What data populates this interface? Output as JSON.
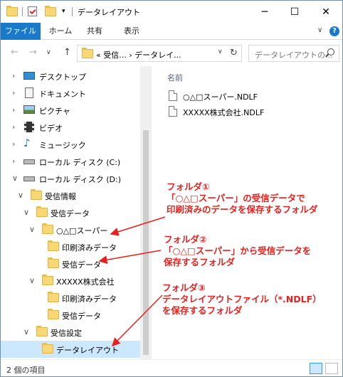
{
  "window": {
    "title": "データレイアウト",
    "minimize": "─",
    "maximize": "☐",
    "close": "✕"
  },
  "ribbon": {
    "tabs": [
      "ファイル",
      "ホーム",
      "共有",
      "表示"
    ],
    "help": "?",
    "chevron": "∨"
  },
  "address": {
    "back": "←",
    "forward": "→",
    "recent": "∨",
    "up": "↑",
    "path": "«  受信...  ›  データレイ...",
    "dropdown": "∨",
    "refresh": "↻",
    "search_placeholder": "データレイアウトの..."
  },
  "tree": [
    {
      "label": "デスクトップ",
      "icon": "desktop-icon",
      "twist": "›"
    },
    {
      "label": "ドキュメント",
      "icon": "documents-icon",
      "twist": "›"
    },
    {
      "label": "ピクチャ",
      "icon": "pictures-icon",
      "twist": "›"
    },
    {
      "label": "ビデオ",
      "icon": "videos-icon",
      "twist": "›"
    },
    {
      "label": "ミュージック",
      "icon": "music-icon",
      "twist": "›"
    },
    {
      "label": "ローカル ディスク (C:)",
      "icon": "drive-icon",
      "twist": "›"
    },
    {
      "label": "ローカル ディスク (D:)",
      "icon": "drive-icon",
      "twist": "∨"
    },
    {
      "label": "受信情報",
      "icon": "folder-icon",
      "twist": "∨"
    },
    {
      "label": "受信データ",
      "icon": "folder-icon",
      "twist": "∨"
    },
    {
      "label": "○△□スーパー",
      "icon": "folder-icon",
      "twist": "∨"
    },
    {
      "label": "印刷済みデータ",
      "icon": "folder-icon",
      "twist": ""
    },
    {
      "label": "受信データ",
      "icon": "folder-icon",
      "twist": ""
    },
    {
      "label": "XXXXX株式会社",
      "icon": "folder-icon",
      "twist": "∨"
    },
    {
      "label": "印刷済みデータ",
      "icon": "folder-icon",
      "twist": ""
    },
    {
      "label": "受信データ",
      "icon": "folder-icon",
      "twist": ""
    },
    {
      "label": "受信設定",
      "icon": "folder-icon",
      "twist": "∨"
    },
    {
      "label": "データレイアウト",
      "icon": "folder-icon",
      "twist": "",
      "selected": true
    }
  ],
  "content": {
    "column_header": "名前",
    "files": [
      "○△□スーパー.NDLF",
      "XXXXX株式会社.NDLF"
    ]
  },
  "status": {
    "item_count": "2 個の項目"
  },
  "annotations": [
    {
      "lines": [
        "フォルダ①",
        "「○△□スーパー」の受信データで",
        "印刷済みのデータを保存するフォルダ"
      ]
    },
    {
      "lines": [
        "フォルダ②",
        "「○△□スーパー」から受信データを",
        "保存するフォルダ"
      ]
    },
    {
      "lines": [
        "フォルダ③",
        "データレイアウトファイル（*.NDLF）",
        "を保存するフォルダ"
      ]
    }
  ],
  "colors": {
    "accent": "#1979ca",
    "annotation": "#e8201c",
    "selection": "#cce8ff"
  }
}
